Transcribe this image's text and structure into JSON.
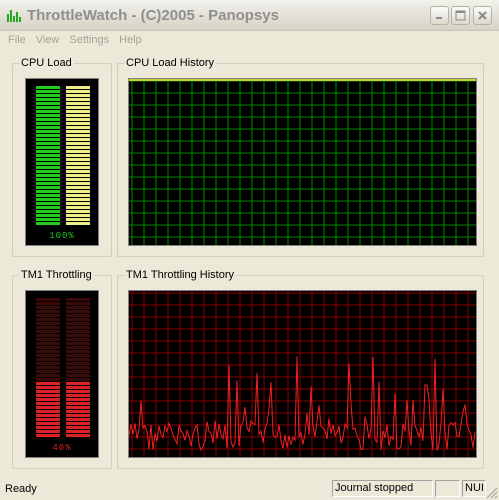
{
  "window": {
    "title": "ThrottleWatch - (C)2005 - Panopsys"
  },
  "menu": {
    "items": [
      "File",
      "View",
      "Settings",
      "Help"
    ]
  },
  "cpu_load": {
    "group_label": "CPU Load",
    "percent_label": "100%",
    "level": 1.0,
    "bar_color": "#22cc22",
    "bar_color_2": "#eeee88"
  },
  "cpu_history": {
    "group_label": "CPU Load History",
    "grid_color": "#008800",
    "line_color": "#cccc33"
  },
  "tm1_throttling": {
    "group_label": "TM1 Throttling",
    "percent_label": "40%",
    "level": 0.4,
    "bar_color": "#dd2222",
    "bar_dim_color": "#3a0a0a"
  },
  "tm1_history": {
    "group_label": "TM1 Throttling History",
    "grid_color": "#880000",
    "line_color": "#ee2222"
  },
  "status": {
    "ready": "Ready",
    "journal": "Journal stopped",
    "indicator": "NUI"
  }
}
